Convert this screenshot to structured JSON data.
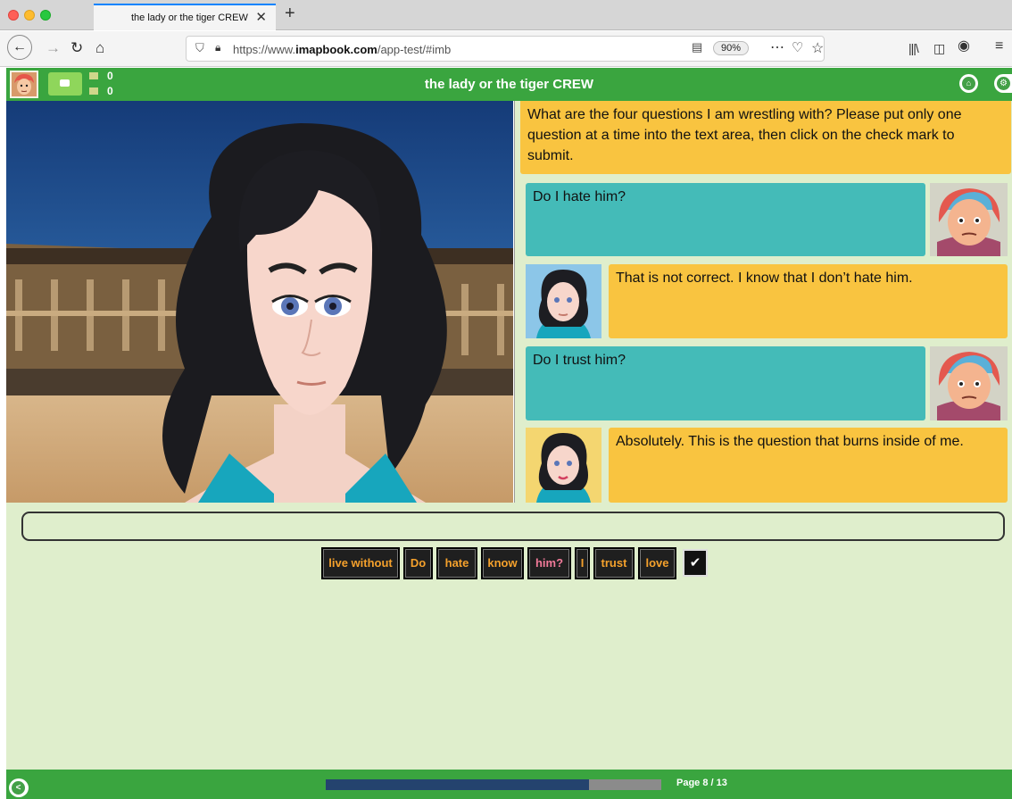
{
  "browser": {
    "tab_title": "the lady or the tiger CREW",
    "tab_close": "✕",
    "new_tab": "+",
    "url_prefix": "https://www.",
    "url_domain": "imapbook.com",
    "url_path": "/app-test/#imb",
    "zoom": "90%"
  },
  "app": {
    "title": "the lady or the tiger CREW",
    "counters": [
      "0",
      "0"
    ],
    "accent_color": "#3aa53f"
  },
  "chat": {
    "prompt": "What are the four questions I am wrestling with? Please put only one question at a time into the text area, then click on the check mark to submit.",
    "messages": [
      {
        "from": "user",
        "text": "Do I hate him?"
      },
      {
        "from": "narrator",
        "text": "That is not correct. I know that I don’t hate him."
      },
      {
        "from": "user",
        "text": "Do I trust him?"
      },
      {
        "from": "narrator",
        "text": "Absolutely. This is the question that burns inside of me."
      }
    ]
  },
  "input": {
    "value": "",
    "words": [
      "live without",
      "Do",
      "hate",
      "know",
      "him?",
      "I",
      "trust",
      "love"
    ],
    "submit_label": "✔"
  },
  "footer": {
    "page_label": "Page 8 / 13",
    "progress_fraction": 0.785
  },
  "icons": {
    "back": "back-arrow-icon",
    "forward": "forward-arrow-icon",
    "reload": "reload-icon",
    "home": "home-icon",
    "shield": "tracking-shield-icon",
    "lock": "lock-icon",
    "reader": "reader-view-icon",
    "more": "more-dots-icon",
    "pocket": "pocket-icon",
    "star": "bookmark-star-icon",
    "library": "library-icon",
    "sidebar": "sidebar-icon",
    "account": "account-icon",
    "menu": "hamburger-menu-icon",
    "chat": "chat-bubble-icon",
    "settings": "settings-gear-icon",
    "prev": "chevron-left-icon"
  }
}
